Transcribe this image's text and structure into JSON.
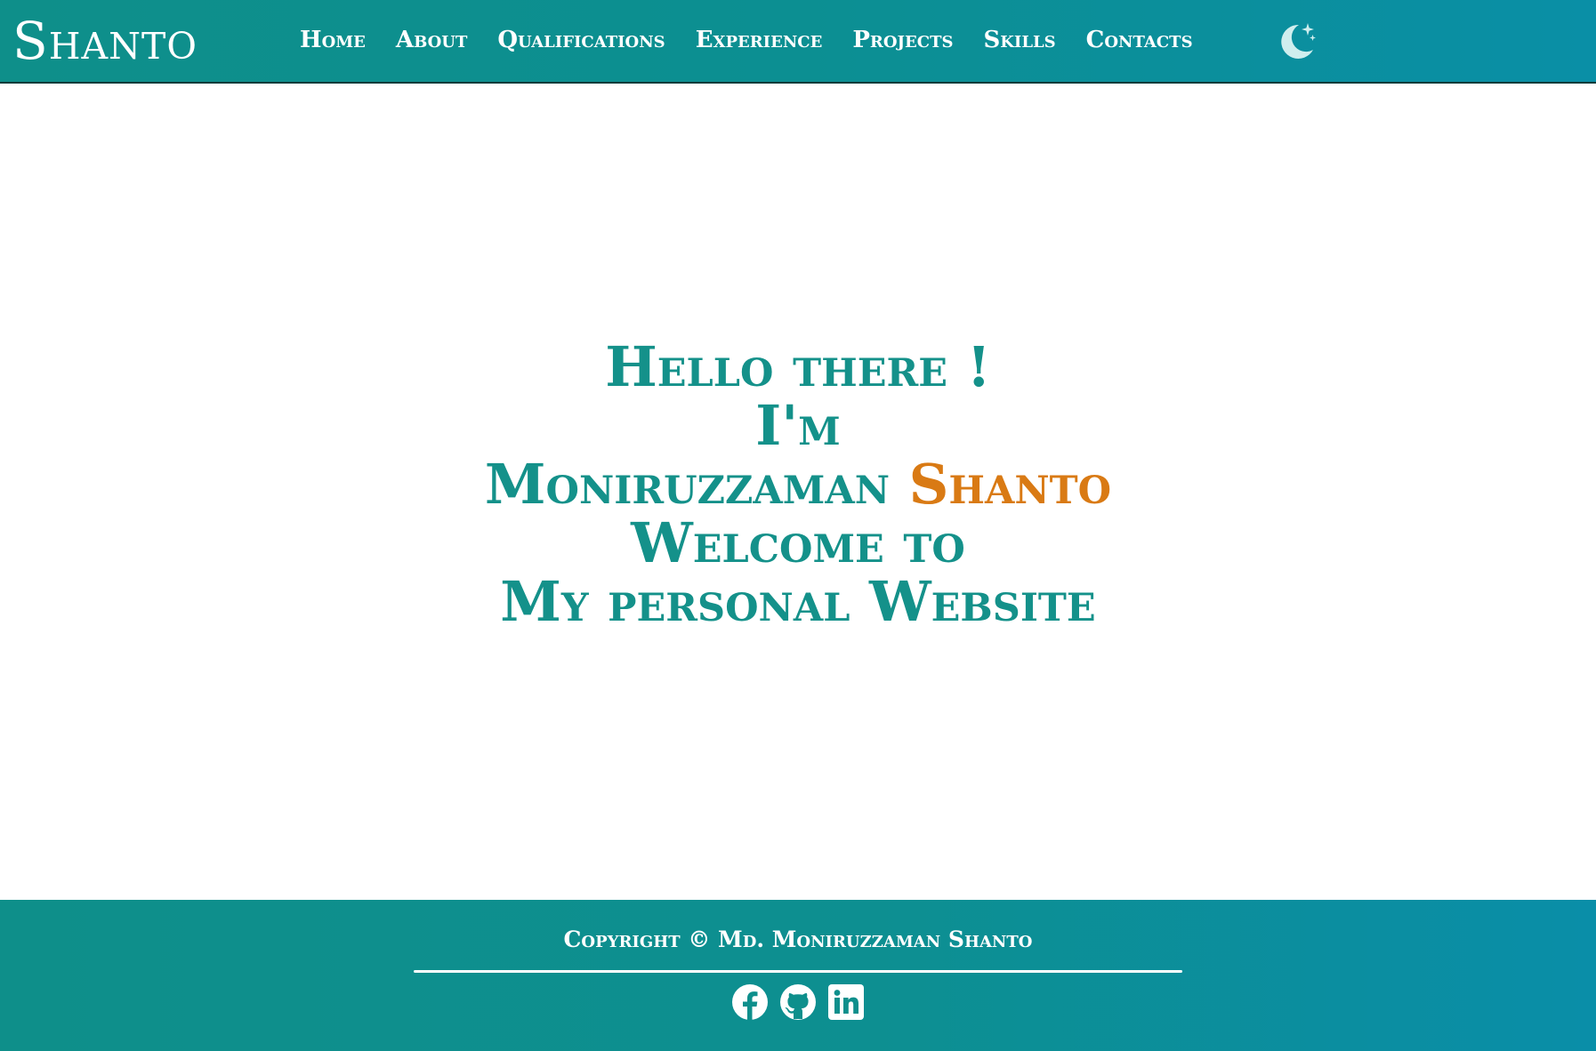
{
  "brand": {
    "name": "Shanto"
  },
  "nav": {
    "items": [
      {
        "label": "Home"
      },
      {
        "label": "About"
      },
      {
        "label": "Qualifications"
      },
      {
        "label": "Experience"
      },
      {
        "label": "Projects"
      },
      {
        "label": "Skills"
      },
      {
        "label": "Contacts"
      }
    ],
    "theme_toggle_icon": "moon-stars-icon"
  },
  "hero": {
    "line1": "Hello there !",
    "line2": "I'm",
    "name_first": "Moniruzzaman",
    "name_last": "Shanto",
    "line4": "Welcome to",
    "line5": "My personal Website"
  },
  "footer": {
    "copyright": "Copyright © Md. Moniruzzaman Shanto",
    "socials": [
      {
        "icon": "facebook-icon"
      },
      {
        "icon": "github-icon"
      },
      {
        "icon": "linkedin-icon"
      }
    ]
  },
  "colors": {
    "primary": "#14918a",
    "accent": "#d97a14",
    "header_bg": "#0e8f8a",
    "text_on_primary": "#ffffff"
  }
}
